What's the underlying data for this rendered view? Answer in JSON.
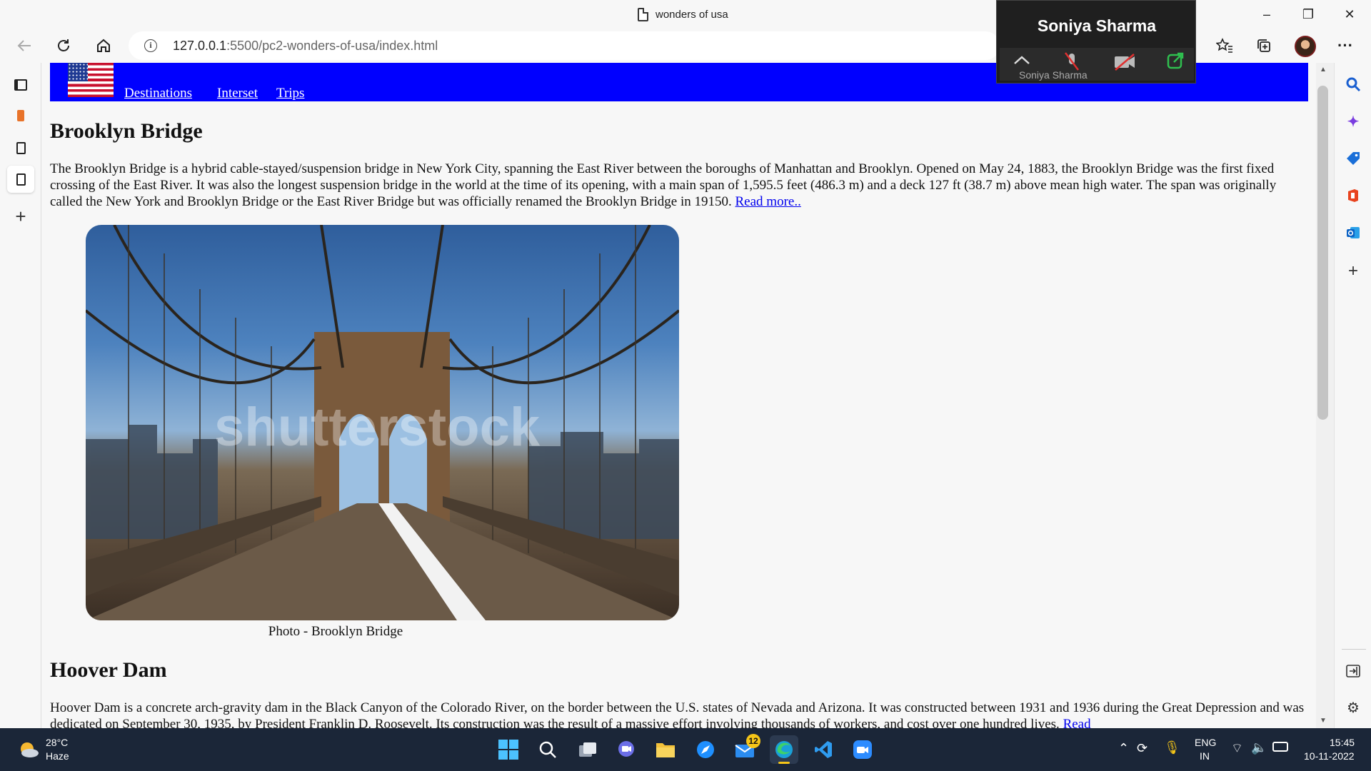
{
  "window": {
    "title": "wonders of usa",
    "minimize_icon": "–",
    "maximize_icon": "❐",
    "close_icon": "✕"
  },
  "addressbar": {
    "url_host": "127.0.0.1",
    "url_path": ":5500/pc2-wonders-of-usa/index.html"
  },
  "zoom_overlay": {
    "name": "Soniya Sharma",
    "small_name": "Soniya Sharma"
  },
  "site_nav": {
    "links": [
      "Destinations",
      "Interset",
      "Trips"
    ]
  },
  "sections": [
    {
      "heading": "Brooklyn Bridge",
      "paragraph": "The Brooklyn Bridge is a hybrid cable-stayed/suspension bridge in New York City, spanning the East River between the boroughs of Manhattan and Brooklyn. Opened on May 24, 1883, the Brooklyn Bridge was the first fixed crossing of the East River. It was also the longest suspension bridge in the world at the time of its opening, with a main span of 1,595.5 feet (486.3 m) and a deck 127 ft (38.7 m) above mean high water. The span was originally called the New York and Brooklyn Bridge or the East River Bridge but was officially renamed the Brooklyn Bridge in 19150.",
      "read_more": "Read more..",
      "caption": "Photo - Brooklyn Bridge",
      "watermark": "shutterstock"
    },
    {
      "heading": "Hoover Dam",
      "paragraph": "Hoover Dam is a concrete arch-gravity dam in the Black Canyon of the Colorado River, on the border between the U.S. states of Nevada and Arizona. It was constructed between 1931 and 1936 during the Great Depression and was dedicated on September 30, 1935, by President Franklin D. Roosevelt. Its construction was the result of a massive effort involving thousands of workers, and cost over one hundred lives.",
      "read_more": "Read"
    }
  ],
  "taskbar": {
    "weather_temp": "28°C",
    "weather_desc": "Haze",
    "mail_badge": "12",
    "lang_top": "ENG",
    "lang_bottom": "IN",
    "time": "15:45",
    "date": "10-11-2022"
  }
}
